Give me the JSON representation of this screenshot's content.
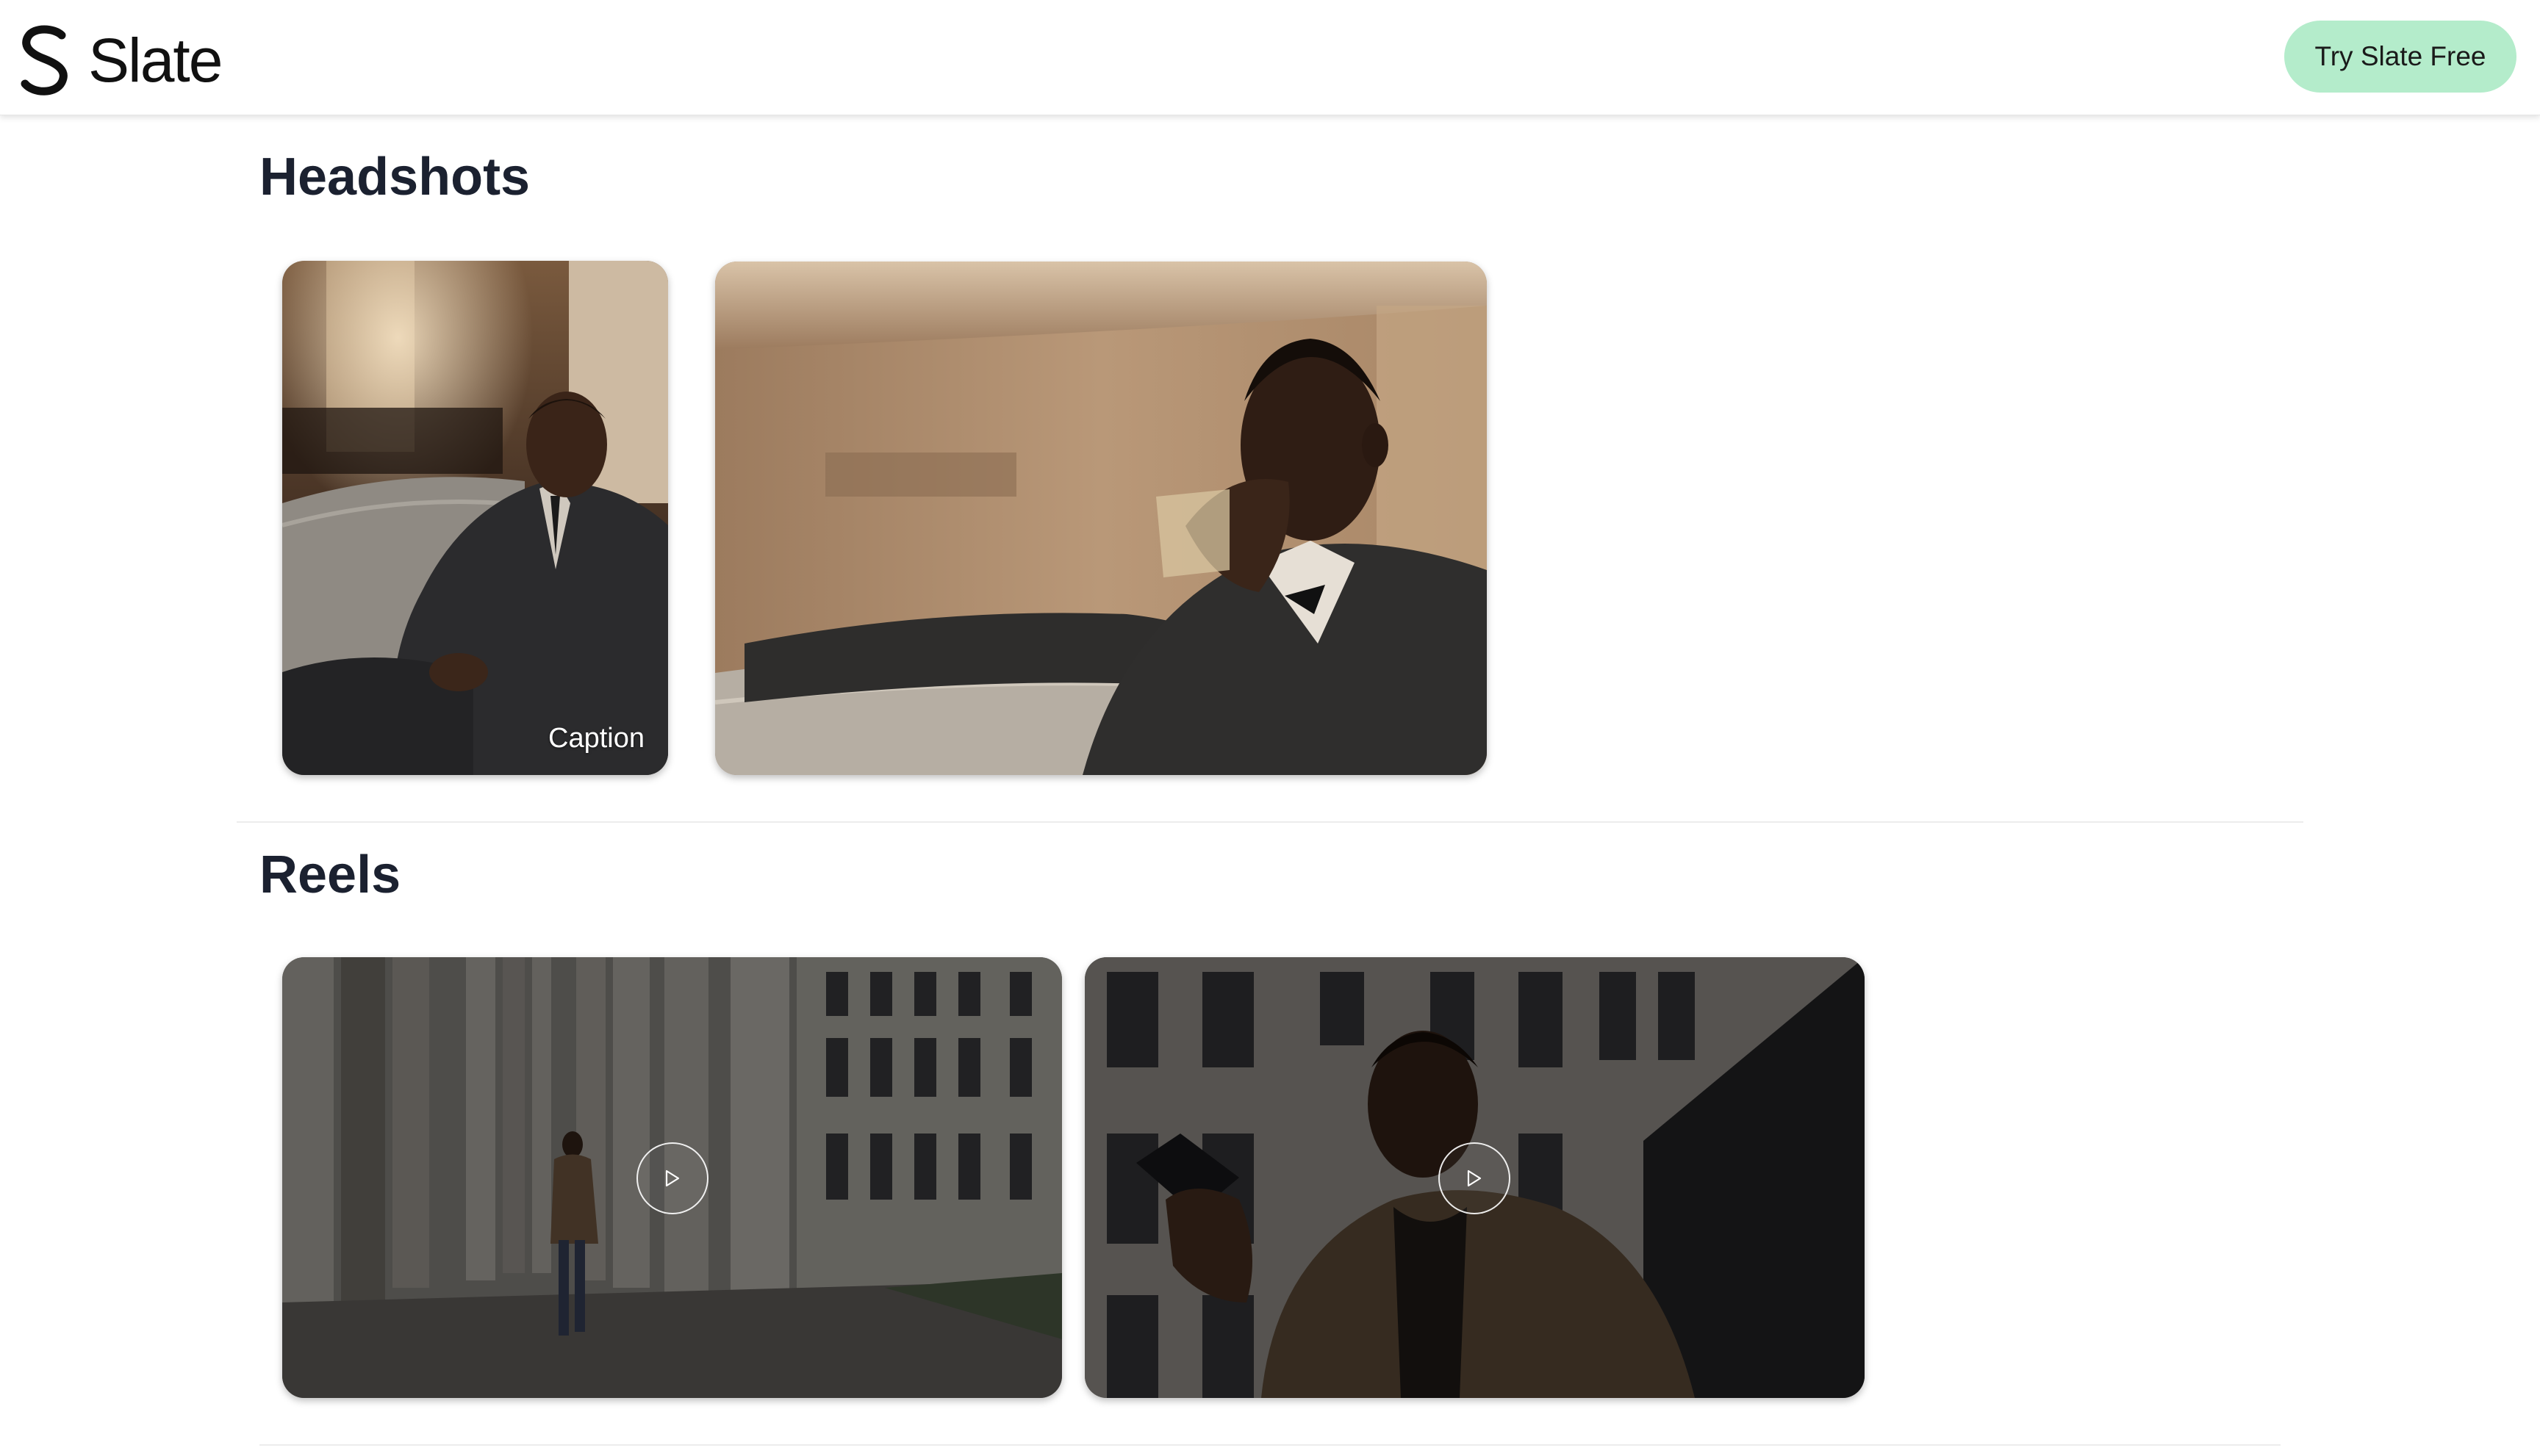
{
  "header": {
    "brand_name": "Slate",
    "cta_label": "Try Slate Free",
    "cta_color": "#b4eccb"
  },
  "sections": [
    {
      "title": "Headshots",
      "items": [
        {
          "type": "photo",
          "caption": "Caption"
        },
        {
          "type": "photo",
          "caption": ""
        }
      ]
    },
    {
      "title": "Reels",
      "items": [
        {
          "type": "video",
          "icon": "play-icon"
        },
        {
          "type": "video",
          "icon": "play-icon"
        }
      ]
    }
  ]
}
